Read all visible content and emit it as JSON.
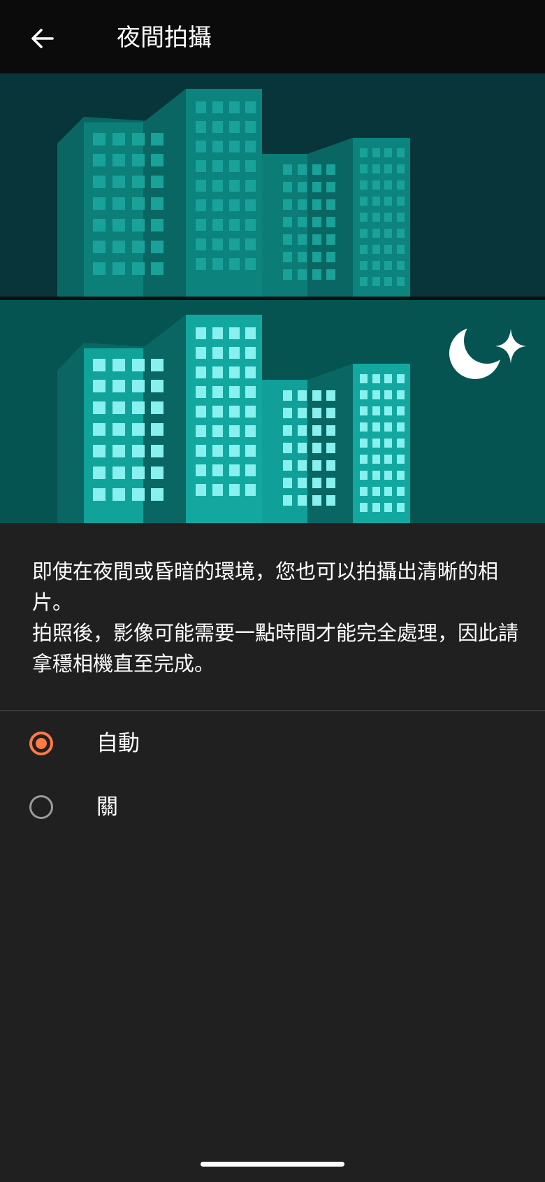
{
  "header": {
    "title": "夜間拍攝",
    "back_icon": "arrow-back-icon"
  },
  "illustration": {
    "icons": [
      "buildings-day-icon",
      "buildings-night-icon",
      "moon-star-icon"
    ],
    "colors": {
      "top_bg": "#07353a",
      "bottom_bg": "#055451",
      "window_dim": "#1aa39b",
      "window_lit": "#88f0ef"
    }
  },
  "description": {
    "paragraph1": "即使在夜間或昏暗的環境，您也可以拍攝出清晰的相片。",
    "paragraph2": "拍照後，影像可能需要一點時間才能完全處理，因此請拿穩相機直至完成。"
  },
  "options": [
    {
      "label": "自動",
      "selected": true
    },
    {
      "label": "關",
      "selected": false
    }
  ],
  "colors": {
    "accent": "#ff7a45",
    "background": "#202020",
    "topbar": "#0b0b0b"
  }
}
